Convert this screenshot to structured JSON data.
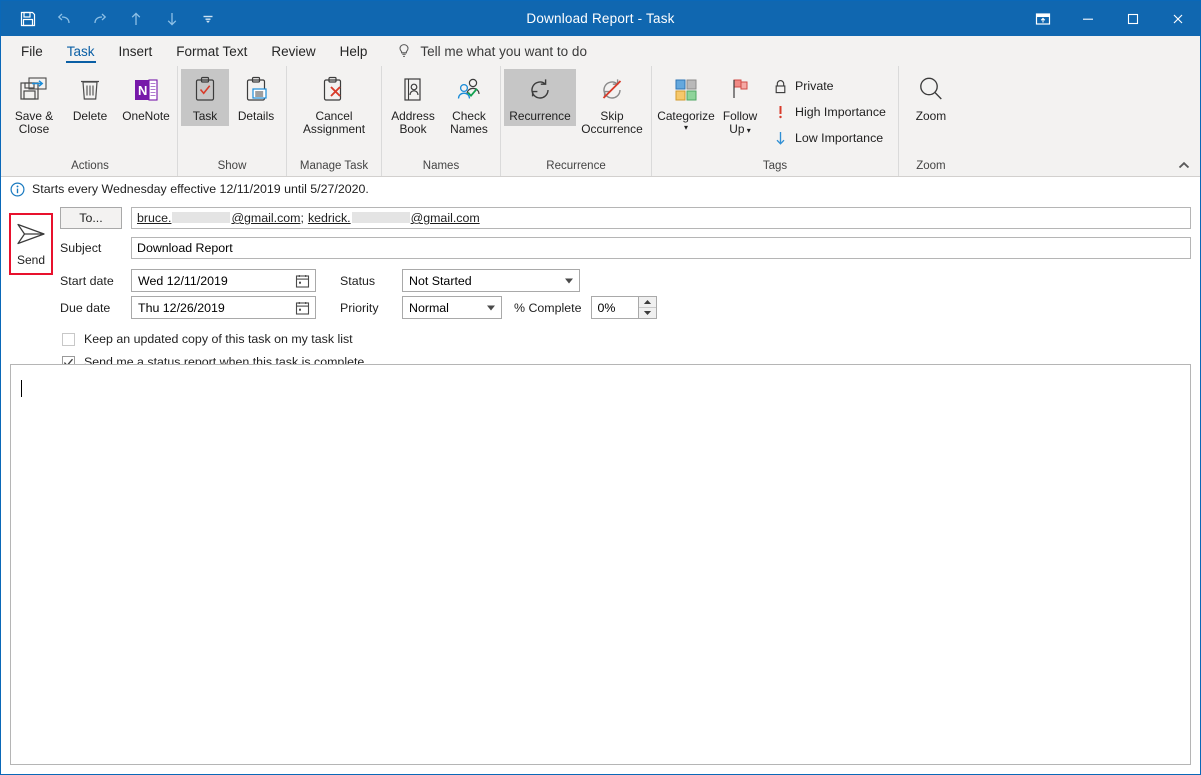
{
  "window": {
    "title": "Download Report  -  Task",
    "quick_access": [
      {
        "name": "save",
        "label": "Save"
      },
      {
        "name": "undo",
        "label": "Undo"
      },
      {
        "name": "redo",
        "label": "Redo"
      },
      {
        "name": "previous-item",
        "label": "Previous Item"
      },
      {
        "name": "next-item",
        "label": "Next Item"
      },
      {
        "name": "customize-quick-access-toolbar",
        "label": "Customize Quick Access Toolbar"
      }
    ],
    "controls": [
      {
        "name": "ribbon-display-options",
        "label": "Ribbon Display Options"
      },
      {
        "name": "minimize",
        "label": "Minimize"
      },
      {
        "name": "maximize",
        "label": "Maximize"
      },
      {
        "name": "close",
        "label": "Close"
      }
    ],
    "accent_color": "#1067b0",
    "highlight_color": "#e8112d"
  },
  "tabs": [
    {
      "label": "File",
      "active": false
    },
    {
      "label": "Task",
      "active": true
    },
    {
      "label": "Insert",
      "active": false
    },
    {
      "label": "Format Text",
      "active": false
    },
    {
      "label": "Review",
      "active": false
    },
    {
      "label": "Help",
      "active": false
    }
  ],
  "tell_me": {
    "icon": "lightbulb-icon",
    "placeholder": "Tell me what you want to do"
  },
  "ribbon": {
    "collapse_label": "Collapse the Ribbon",
    "groups": [
      {
        "label": "Actions",
        "buttons": [
          {
            "name": "save-and-close",
            "line1": "Save &",
            "line2": "Close",
            "icon": "save-and-close-icon",
            "selected": false
          },
          {
            "name": "delete",
            "line1": "Delete",
            "line2": "",
            "icon": "trash-icon",
            "selected": false
          },
          {
            "name": "onenote",
            "line1": "OneNote",
            "line2": "",
            "icon": "onenote-icon",
            "selected": false
          }
        ]
      },
      {
        "label": "Show",
        "buttons": [
          {
            "name": "task",
            "line1": "Task",
            "line2": "",
            "icon": "clipboard-check-icon",
            "selected": true
          },
          {
            "name": "details",
            "line1": "Details",
            "line2": "",
            "icon": "clipboard-details-icon",
            "selected": false
          }
        ]
      },
      {
        "label": "Manage Task",
        "buttons": [
          {
            "name": "cancel-assignment",
            "line1": "Cancel",
            "line2": "Assignment",
            "icon": "clipboard-cancel-icon",
            "selected": false
          }
        ]
      },
      {
        "label": "Names",
        "buttons": [
          {
            "name": "address-book",
            "line1": "Address",
            "line2": "Book",
            "icon": "address-book-icon",
            "selected": false
          },
          {
            "name": "check-names",
            "line1": "Check",
            "line2": "Names",
            "icon": "check-names-icon",
            "selected": false
          }
        ]
      },
      {
        "label": "Recurrence",
        "buttons": [
          {
            "name": "recurrence",
            "line1": "Recurrence",
            "line2": "",
            "icon": "recurrence-icon",
            "selected": true
          },
          {
            "name": "skip-occurrence",
            "line1": "Skip",
            "line2": "Occurrence",
            "icon": "skip-occurrence-icon",
            "selected": false
          }
        ]
      },
      {
        "label": "Tags",
        "buttons": [
          {
            "name": "categorize",
            "line1": "Categorize",
            "line2": "",
            "icon": "categorize-icon",
            "selected": false,
            "caret": "▾"
          },
          {
            "name": "follow-up",
            "line1": "Follow",
            "line2": "Up",
            "icon": "flag-icon",
            "selected": false,
            "caret": "▾"
          }
        ],
        "small_items": [
          {
            "name": "private",
            "label": "Private",
            "icon": "lock-icon"
          },
          {
            "name": "high-importance",
            "label": "High Importance",
            "icon": "exclamation-icon"
          },
          {
            "name": "low-importance",
            "label": "Low Importance",
            "icon": "down-arrow-icon"
          }
        ]
      },
      {
        "label": "Zoom",
        "buttons": [
          {
            "name": "zoom",
            "line1": "Zoom",
            "line2": "",
            "icon": "magnifier-icon",
            "selected": false
          }
        ]
      }
    ]
  },
  "info_bar": {
    "icon": "info-circle-icon",
    "text": "Starts every Wednesday effective 12/11/2019 until 5/27/2020."
  },
  "form": {
    "send_button": {
      "label": "Send",
      "icon": "send-arrow-icon"
    },
    "to": {
      "button_label": "To...",
      "recipient1_prefix": "bruce.",
      "recipient1_suffix": "@gmail.com",
      "separator": ";",
      "recipient2_prefix": "kedrick.",
      "recipient2_suffix": "@gmail.com"
    },
    "subject": {
      "label": "Subject",
      "value": "Download Report"
    },
    "start_date": {
      "label": "Start date",
      "value": "Wed 12/11/2019",
      "icon": "calendar-icon"
    },
    "due_date": {
      "label": "Due date",
      "value": "Thu 12/26/2019",
      "icon": "calendar-icon"
    },
    "status": {
      "label": "Status",
      "value": "Not Started"
    },
    "priority": {
      "label": "Priority",
      "value": "Normal"
    },
    "percent_complete": {
      "label": "% Complete",
      "value": "0%"
    },
    "checkbox_keep_copy": {
      "label": "Keep an updated copy of this task on my task list",
      "checked": false
    },
    "checkbox_status_report": {
      "label": "Send me a status report when this task is complete",
      "checked": true
    }
  },
  "body": {
    "text": ""
  }
}
